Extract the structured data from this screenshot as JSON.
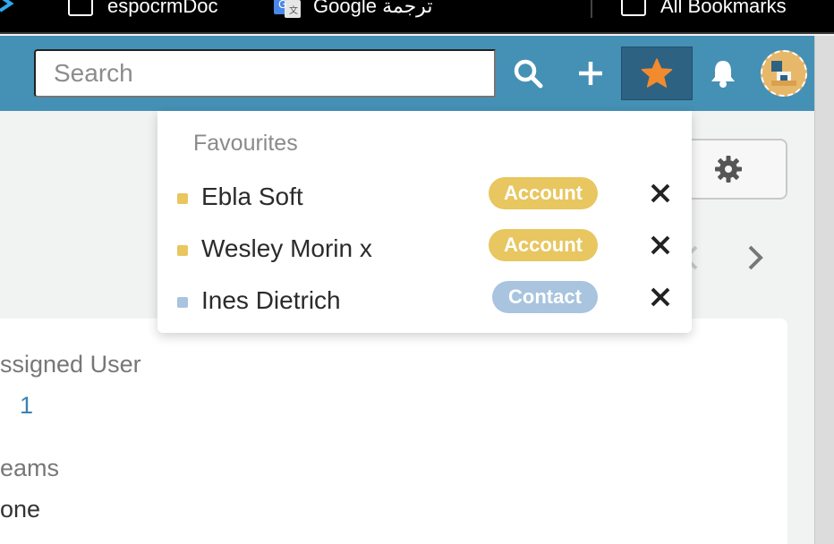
{
  "bookmarks_bar": {
    "items": [
      {
        "label": "espocrmDoc",
        "icon": "folder-icon"
      },
      {
        "label": "Google ترجمة",
        "icon": "google-translate-icon"
      },
      {
        "label": "All Bookmarks",
        "icon": "folder-icon"
      }
    ]
  },
  "navbar": {
    "search_placeholder": "Search",
    "icons": [
      "search-icon",
      "plus-icon",
      "star-icon",
      "bell-icon",
      "avatar"
    ],
    "color": "#4590b5",
    "active_color": "#2d6282",
    "star_color": "#f28a2e"
  },
  "favourites": {
    "title": "Favourites",
    "items": [
      {
        "name": "Ebla Soft",
        "type": "Account",
        "dot_color": "#e8c660",
        "badge_color": "#e8c660"
      },
      {
        "name": "Wesley Morin x",
        "type": "Account",
        "dot_color": "#e8c660",
        "badge_color": "#e8c660"
      },
      {
        "name": "Ines Dietrich",
        "type": "Contact",
        "dot_color": "#a8c4de",
        "badge_color": "#a8c4de"
      }
    ]
  },
  "detail": {
    "assigned_user_label": "ssigned User",
    "assigned_user_value": "1",
    "teams_label": "eams",
    "teams_value": "one"
  }
}
